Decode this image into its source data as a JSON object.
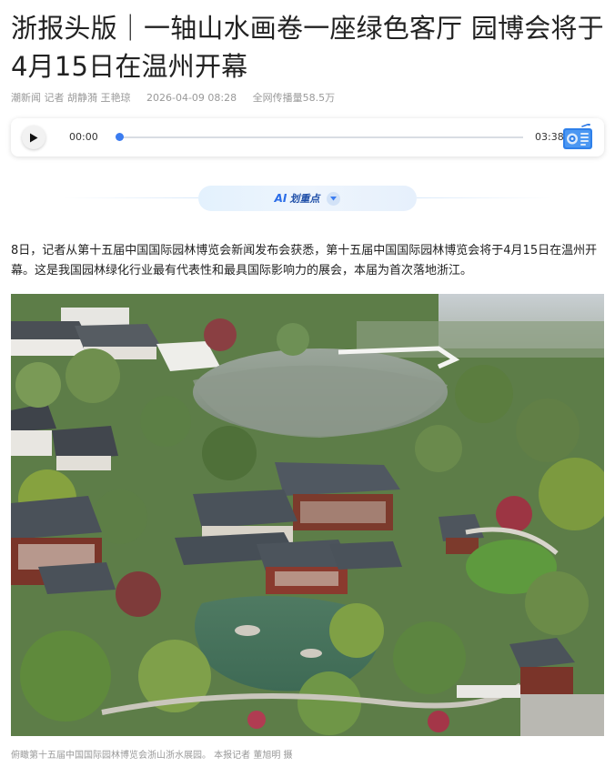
{
  "article": {
    "title": "浙报头版｜一轴山水画卷一座绿色客厅 园博会将于4月15日在温州开幕",
    "meta": {
      "source": "潮新闻 记者 胡静漪 王艳琼",
      "time": "2026-04-09 08:28",
      "reach": "全网传播量58.5万"
    },
    "audio": {
      "current": "00:00",
      "total": "03:38",
      "progress": 0,
      "play_icon": "play-icon",
      "radio_icon": "radio-icon"
    },
    "ai_summary": {
      "mark": "AI",
      "label": "划重点",
      "icon": "chevron-down-icon"
    },
    "paragraph": " 8日，记者从第十五届中国国际园林博览会新闻发布会获悉，第十五届中国国际园林博览会将于4月15日在温州开幕。这是我国园林绿化行业最有代表性和最具国际影响力的展会，本届为首次落地浙江。",
    "photo": {
      "caption": "俯瞰第十五届中国国际园林博览会浙山浙水展园。 本报记者 董旭明 摄"
    },
    "colors": {
      "accent": "#3b7cf0",
      "meta_text": "#999999",
      "ai_label": "#1f4fa8"
    }
  }
}
